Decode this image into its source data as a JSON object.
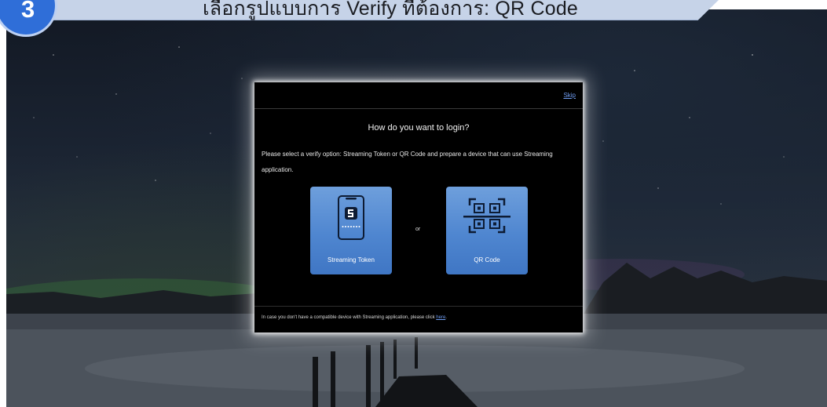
{
  "step": {
    "number": "3",
    "instruction": "เลือกรูปแบบการ Verify ที่ต้องการ: QR Code"
  },
  "dialog": {
    "skip_label": "Skip",
    "title": "How do you want to login?",
    "description": "Please select a verify option: Streaming Token or QR Code and prepare a device that can use Streaming application.",
    "separator": "or",
    "options": [
      {
        "label": "Streaming Token",
        "icon": "phone-token-icon"
      },
      {
        "label": "QR Code",
        "icon": "qr-code-icon"
      }
    ],
    "footer_text": "In case you don't have a compatible device with Streaming application, please click",
    "footer_link": "here",
    "footer_end": "."
  },
  "colors": {
    "step_badge": "#2f6ed8",
    "banner": "#c6d3e8",
    "option_tile": "#5a8fd6",
    "link": "#6f9cf0",
    "dialog_bg": "#000000"
  }
}
